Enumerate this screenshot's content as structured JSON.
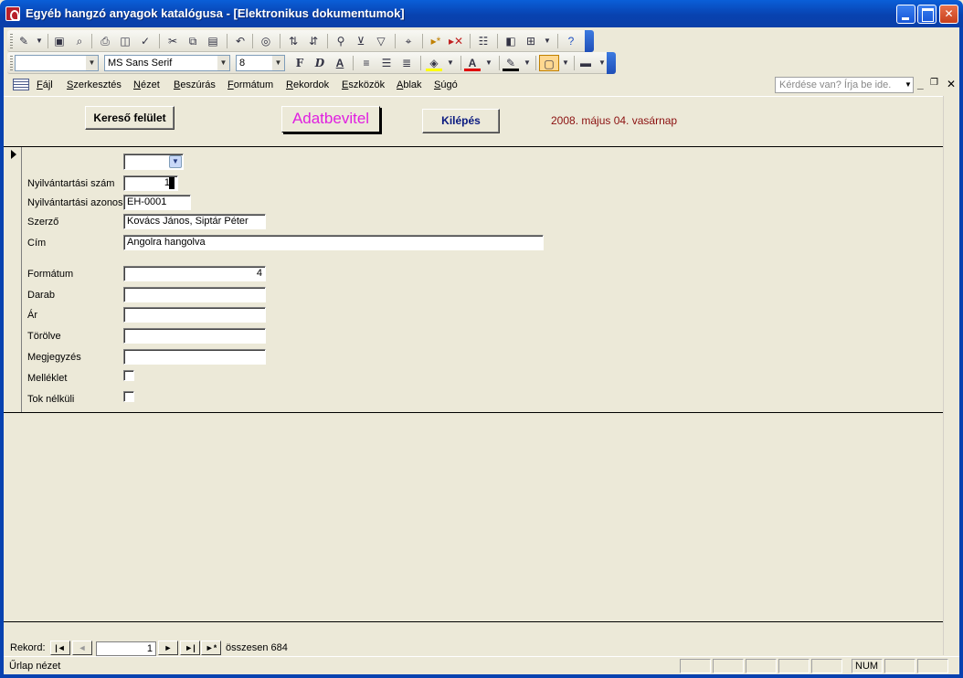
{
  "window": {
    "title": "Egyéb hangzó anyagok katalógusa - [Elektronikus dokumentumok]",
    "controls": {
      "minimize": "",
      "maximize": "",
      "close": "✕"
    }
  },
  "toolbar2": {
    "object_combo": "",
    "font_name": "MS Sans Serif",
    "font_size": "8",
    "bold": "F",
    "italic": "D",
    "underline": "A"
  },
  "menu": {
    "items": [
      "Fájl",
      "Szerkesztés",
      "Nézet",
      "Beszúrás",
      "Formátum",
      "Rekordok",
      "Eszközök",
      "Ablak",
      "Súgó"
    ],
    "help_placeholder": "Kérdése van? Írja be ide.",
    "mdi_minimize": "_",
    "mdi_restore": "❐",
    "mdi_close": "✕"
  },
  "header": {
    "search_button": "Kereső felület",
    "entry_button": "Adatbevitel",
    "exit_button": "Kilépés",
    "date": "2008. május 04. vasárnap"
  },
  "form": {
    "combo_value": "",
    "fields": [
      {
        "label": "Nyilvántartási szám",
        "value": "1"
      },
      {
        "label": "Nyilvántartási azonos",
        "value": "EH-0001"
      },
      {
        "label": "Szerző",
        "value": "Kovács János, Siptár Péter"
      },
      {
        "label": "Cím",
        "value": "Angolra hangolva"
      },
      {
        "label": "Formátum",
        "value": "4"
      },
      {
        "label": "Darab",
        "value": ""
      },
      {
        "label": "Ár",
        "value": ""
      },
      {
        "label": "Törölve",
        "value": ""
      },
      {
        "label": "Megjegyzés",
        "value": ""
      }
    ],
    "checkboxes": [
      {
        "label": "Melléklet",
        "checked": false
      },
      {
        "label": "Tok nélküli",
        "checked": false
      }
    ]
  },
  "navigation": {
    "label": "Rekord:",
    "current": "1",
    "total_label": "összesen",
    "total": "684",
    "first": "|◄",
    "prev": "◄",
    "next": "►",
    "last": "►|",
    "new": "►*"
  },
  "status": {
    "text": "Űrlap nézet",
    "num": "NUM"
  }
}
